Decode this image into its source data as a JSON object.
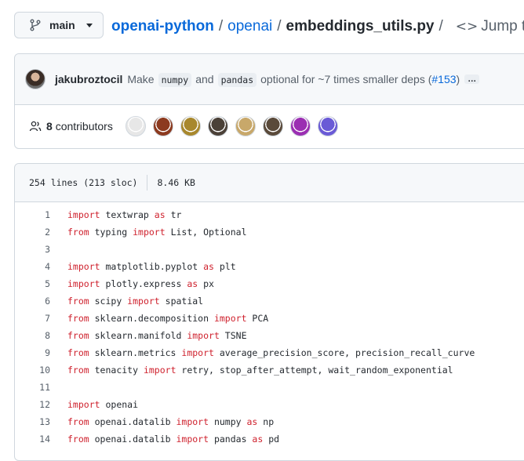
{
  "branch": {
    "label": "main"
  },
  "breadcrumb": {
    "repo": "openai-python",
    "folder": "openai",
    "file": "embeddings_utils.py",
    "sep": "/",
    "jump_label": "Jump to"
  },
  "commit": {
    "author": "jakubroztocil",
    "message_parts": [
      "Make",
      "numpy",
      "and",
      "pandas",
      "optional for ~7 times smaller deps ("
    ],
    "pr_link": "#153",
    "close_paren": ")",
    "ellipsis": "…"
  },
  "contributors": {
    "count": "8",
    "label": "contributors",
    "avatar_colors": [
      "#e7e7e7",
      "#8c3a1f",
      "#a8882d",
      "#4b4138",
      "#c8a86a",
      "#5a4a3a",
      "#9b2fb2",
      "#6a5ad6"
    ]
  },
  "file_info": {
    "lines": "254 lines (213 sloc)",
    "size": "8.46 KB"
  },
  "code_lines": [
    {
      "n": "1",
      "tokens": [
        {
          "k": true,
          "t": "import"
        },
        {
          "t": " textwrap "
        },
        {
          "k": true,
          "t": "as"
        },
        {
          "t": " tr"
        }
      ]
    },
    {
      "n": "2",
      "tokens": [
        {
          "k": true,
          "t": "from"
        },
        {
          "t": " typing "
        },
        {
          "k": true,
          "t": "import"
        },
        {
          "t": " List, Optional"
        }
      ]
    },
    {
      "n": "3",
      "tokens": []
    },
    {
      "n": "4",
      "tokens": [
        {
          "k": true,
          "t": "import"
        },
        {
          "t": " matplotlib.pyplot "
        },
        {
          "k": true,
          "t": "as"
        },
        {
          "t": " plt"
        }
      ]
    },
    {
      "n": "5",
      "tokens": [
        {
          "k": true,
          "t": "import"
        },
        {
          "t": " plotly.express "
        },
        {
          "k": true,
          "t": "as"
        },
        {
          "t": " px"
        }
      ]
    },
    {
      "n": "6",
      "tokens": [
        {
          "k": true,
          "t": "from"
        },
        {
          "t": " scipy "
        },
        {
          "k": true,
          "t": "import"
        },
        {
          "t": " spatial"
        }
      ]
    },
    {
      "n": "7",
      "tokens": [
        {
          "k": true,
          "t": "from"
        },
        {
          "t": " sklearn.decomposition "
        },
        {
          "k": true,
          "t": "import"
        },
        {
          "t": " PCA"
        }
      ]
    },
    {
      "n": "8",
      "tokens": [
        {
          "k": true,
          "t": "from"
        },
        {
          "t": " sklearn.manifold "
        },
        {
          "k": true,
          "t": "import"
        },
        {
          "t": " TSNE"
        }
      ]
    },
    {
      "n": "9",
      "tokens": [
        {
          "k": true,
          "t": "from"
        },
        {
          "t": " sklearn.metrics "
        },
        {
          "k": true,
          "t": "import"
        },
        {
          "t": " average_precision_score, precision_recall_curve"
        }
      ]
    },
    {
      "n": "10",
      "tokens": [
        {
          "k": true,
          "t": "from"
        },
        {
          "t": " tenacity "
        },
        {
          "k": true,
          "t": "import"
        },
        {
          "t": " retry, stop_after_attempt, wait_random_exponential"
        }
      ]
    },
    {
      "n": "11",
      "tokens": []
    },
    {
      "n": "12",
      "tokens": [
        {
          "k": true,
          "t": "import"
        },
        {
          "t": " openai"
        }
      ]
    },
    {
      "n": "13",
      "tokens": [
        {
          "k": true,
          "t": "from"
        },
        {
          "t": " openai.datalib "
        },
        {
          "k": true,
          "t": "import"
        },
        {
          "t": " numpy "
        },
        {
          "k": true,
          "t": "as"
        },
        {
          "t": " np"
        }
      ]
    },
    {
      "n": "14",
      "tokens": [
        {
          "k": true,
          "t": "from"
        },
        {
          "t": " openai.datalib "
        },
        {
          "k": true,
          "t": "import"
        },
        {
          "t": " pandas "
        },
        {
          "k": true,
          "t": "as"
        },
        {
          "t": " pd"
        }
      ]
    }
  ]
}
